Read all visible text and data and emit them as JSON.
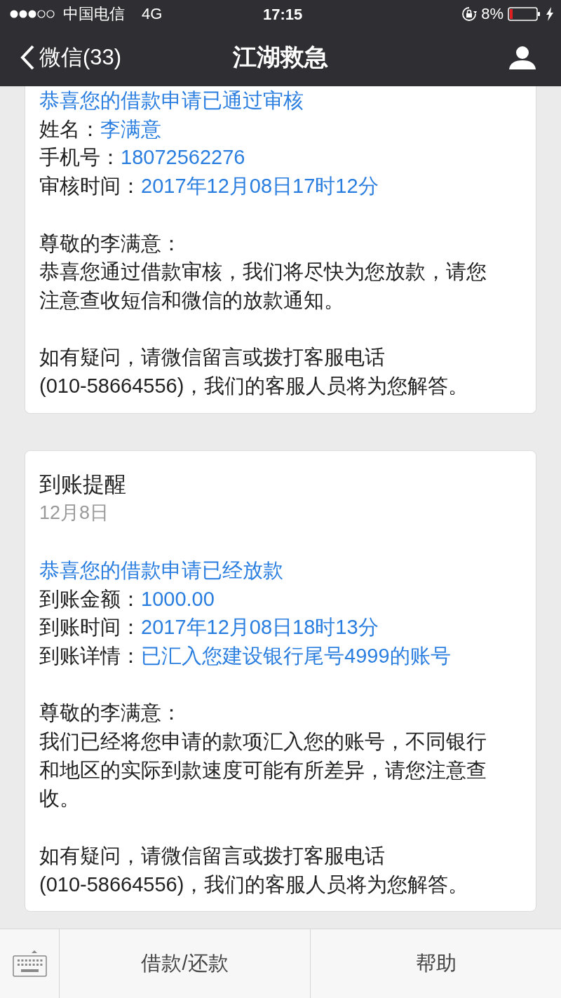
{
  "status_bar": {
    "carrier": "中国电信",
    "network": "4G",
    "time": "17:15",
    "battery": "8%"
  },
  "nav": {
    "back": "微信(33)",
    "title": "江湖救急"
  },
  "cards": [
    {
      "headline": "恭喜您的借款申请已通过审核",
      "fields": [
        {
          "label": "姓名：",
          "value": "李满意"
        },
        {
          "label": "手机号：",
          "value": "18072562276"
        },
        {
          "label": "审核时间：",
          "value": "2017年12月08日17时12分"
        }
      ],
      "greeting": "尊敬的李满意：",
      "body": "恭喜您通过借款审核，我们将尽快为您放款，请您注意查收短信和微信的放款通知。",
      "contact": "如有疑问，请微信留言或拨打客服电话\n(010-58664556)，我们的客服人员将为您解答。"
    },
    {
      "title": "到账提醒",
      "date": "12月8日",
      "headline": "恭喜您的借款申请已经放款",
      "fields": [
        {
          "label": "到账金额：",
          "value": "1000.00"
        },
        {
          "label": "到账时间：",
          "value": "2017年12月08日18时13分"
        },
        {
          "label": "到账详情：",
          "value": "已汇入您建设银行尾号4999的账号"
        }
      ],
      "greeting": "尊敬的李满意：",
      "body": "我们已经将您申请的款项汇入您的账号，不同银行和地区的实际到款速度可能有所差异，请您注意查收。",
      "contact": "如有疑问，请微信留言或拨打客服电话\n(010-58664556)，我们的客服人员将为您解答。"
    }
  ],
  "menu": [
    "借款/还款",
    "帮助"
  ]
}
